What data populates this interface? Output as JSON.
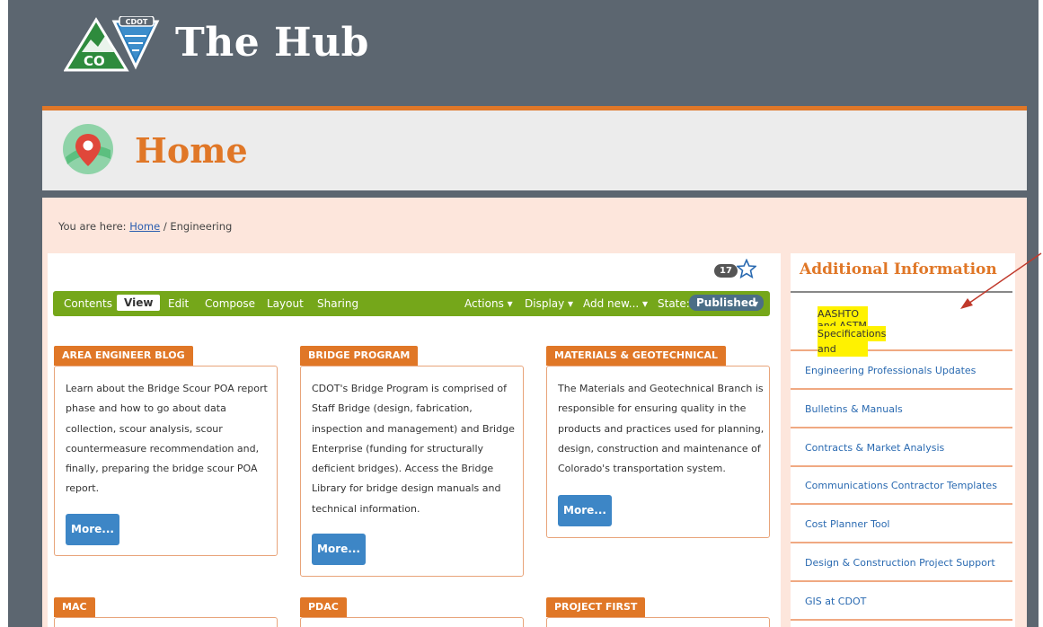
{
  "app": {
    "title": "The Hub"
  },
  "page": {
    "title": "Home"
  },
  "breadcrumb": {
    "prefix": "You are here:",
    "home": "Home",
    "separator": "/",
    "current": "Engineering"
  },
  "counter": {
    "count": "17"
  },
  "toolbar": {
    "contents": "Contents",
    "view": "View",
    "edit": "Edit",
    "compose": "Compose",
    "layout": "Layout",
    "sharing": "Sharing",
    "actions": "Actions ▾",
    "display": "Display ▾",
    "add_new": "Add new... ▾",
    "state_label": "State:",
    "state_value": "Published",
    "state_caret": "▾"
  },
  "cards": [
    {
      "title": "AREA ENGINEER BLOG",
      "lines": [
        "Learn about the Bridge Scour POA report",
        "phase and how to go about data",
        "collection, scour analysis, scour",
        "countermeasure recommendation and,",
        "finally, preparing the bridge scour POA",
        "report."
      ],
      "more": "More..."
    },
    {
      "title": "BRIDGE PROGRAM",
      "lines": [
        "CDOT's Bridge Program is comprised of",
        "Staff Bridge (design, fabrication,",
        "inspection and management) and Bridge",
        "Enterprise (funding for structurally",
        "deficient bridges). Access the Bridge",
        "Library for bridge design manuals and",
        "technical information."
      ],
      "more": "More..."
    },
    {
      "title": "MATERIALS & GEOTECHNICAL",
      "lines": [
        "The Materials and Geotechnical Branch is",
        "responsible for ensuring quality in the",
        "products and practices used for planning,",
        "design, construction and maintenance of",
        "Colorado's transportation system."
      ],
      "more": "More..."
    },
    {
      "title": "MAC"
    },
    {
      "title": "PDAC"
    },
    {
      "title": "PROJECT FIRST"
    }
  ],
  "sidebar": {
    "title": "Additional Information",
    "items": [
      {
        "label_line1": "AASHTO and ASTM Standards and",
        "label_line2": "Specifications"
      },
      {
        "label": "Engineering Professionals Updates"
      },
      {
        "label": "Bulletins & Manuals"
      },
      {
        "label": "Contracts & Market Analysis"
      },
      {
        "label": "Communications Contractor Templates"
      },
      {
        "label": "Cost Planner Tool"
      },
      {
        "label": "Design & Construction Project Support"
      },
      {
        "label": "GIS at CDOT"
      }
    ]
  },
  "logo": {
    "badge_text": "CDOT",
    "state_text": "CO"
  },
  "colors": {
    "frame": "#5c6670",
    "accent_orange": "#e07727",
    "toolbar_green": "#75a71a",
    "link_blue": "#2a6ab1",
    "highlight_yellow": "#fff200",
    "button_blue": "#3d86c6"
  },
  "icons": [
    "logo-icon",
    "map-pin-icon",
    "star-icon",
    "arrow-annotation-icon"
  ]
}
